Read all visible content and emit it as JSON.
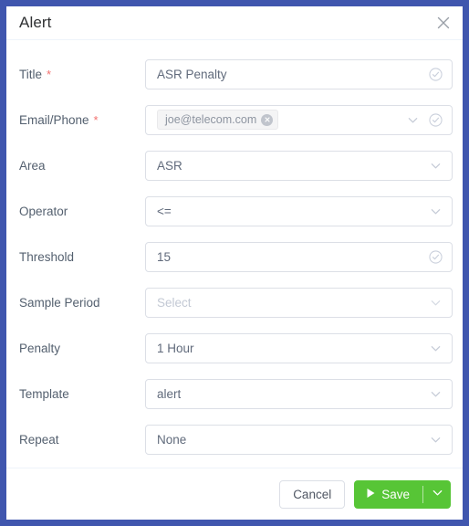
{
  "dialog": {
    "title": "Alert",
    "close_icon": "close-icon"
  },
  "form": {
    "rows": [
      {
        "label": "Title",
        "required": true,
        "control": "text",
        "value": "ASR Penalty",
        "placeholder": "",
        "has_check": true,
        "has_chevron": false
      },
      {
        "label": "Email/Phone",
        "required": true,
        "control": "tags",
        "value": "",
        "tags": [
          "joe@telecom.com"
        ],
        "placeholder": "",
        "has_check": true,
        "has_chevron": true
      },
      {
        "label": "Area",
        "required": false,
        "control": "select",
        "value": "ASR",
        "placeholder": "",
        "has_check": false,
        "has_chevron": true
      },
      {
        "label": "Operator",
        "required": false,
        "control": "select",
        "value": "<=",
        "placeholder": "",
        "has_check": false,
        "has_chevron": true
      },
      {
        "label": "Threshold",
        "required": false,
        "control": "text",
        "value": "15",
        "placeholder": "",
        "has_check": true,
        "has_chevron": false
      },
      {
        "label": "Sample Period",
        "required": false,
        "control": "select",
        "value": "",
        "placeholder": "Select",
        "has_check": false,
        "has_chevron": true
      },
      {
        "label": "Penalty",
        "required": false,
        "control": "select",
        "value": "1 Hour",
        "placeholder": "",
        "has_check": false,
        "has_chevron": true
      },
      {
        "label": "Template",
        "required": false,
        "control": "select",
        "value": "alert",
        "placeholder": "",
        "has_check": false,
        "has_chevron": true
      },
      {
        "label": "Repeat",
        "required": false,
        "control": "select",
        "value": "None",
        "placeholder": "",
        "has_check": false,
        "has_chevron": true
      }
    ],
    "required_marker": "*"
  },
  "footer": {
    "cancel_label": "Cancel",
    "save_label": "Save",
    "save_icon": "play-icon",
    "save_caret_icon": "chevron-down-icon"
  },
  "colors": {
    "modal_border": "#4056ae",
    "save_green": "#57c536",
    "required_red": "#f2706e",
    "label_text": "#54606f",
    "value_text": "#606a7b",
    "placeholder_text": "#c3c9d4",
    "field_border": "#dcdfe6"
  }
}
